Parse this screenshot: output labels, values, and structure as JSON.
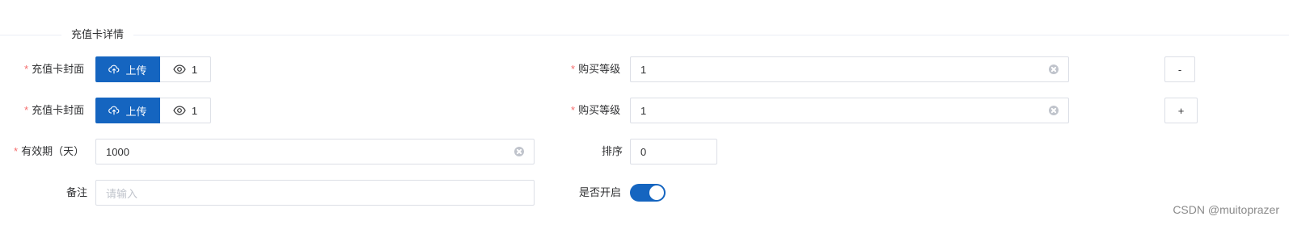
{
  "section": {
    "title": "充值卡详情"
  },
  "form": {
    "required_mark": "*",
    "cover_rows": [
      {
        "label": "充值卡封面",
        "upload_label": "上传",
        "view_count": "1"
      },
      {
        "label": "充值卡封面",
        "upload_label": "上传",
        "view_count": "1"
      }
    ],
    "level_rows": [
      {
        "label": "购买等级",
        "value": "1",
        "action_label": "-"
      },
      {
        "label": "购买等级",
        "value": "1",
        "action_label": "+"
      }
    ],
    "validity": {
      "label": "有效期（天）",
      "value": "1000"
    },
    "sort": {
      "label": "排序",
      "value": "0"
    },
    "remark": {
      "label": "备注",
      "placeholder": "请输入"
    },
    "enable": {
      "label": "是否开启",
      "on": true
    }
  },
  "colors": {
    "primary": "#1565c0",
    "required": "#f56c6c",
    "border": "#dcdfe6"
  },
  "icons": {
    "upload": "cloud-upload-icon",
    "view": "eye-icon",
    "clear": "clear-circle-icon"
  },
  "watermark": "CSDN @muitoprazer"
}
